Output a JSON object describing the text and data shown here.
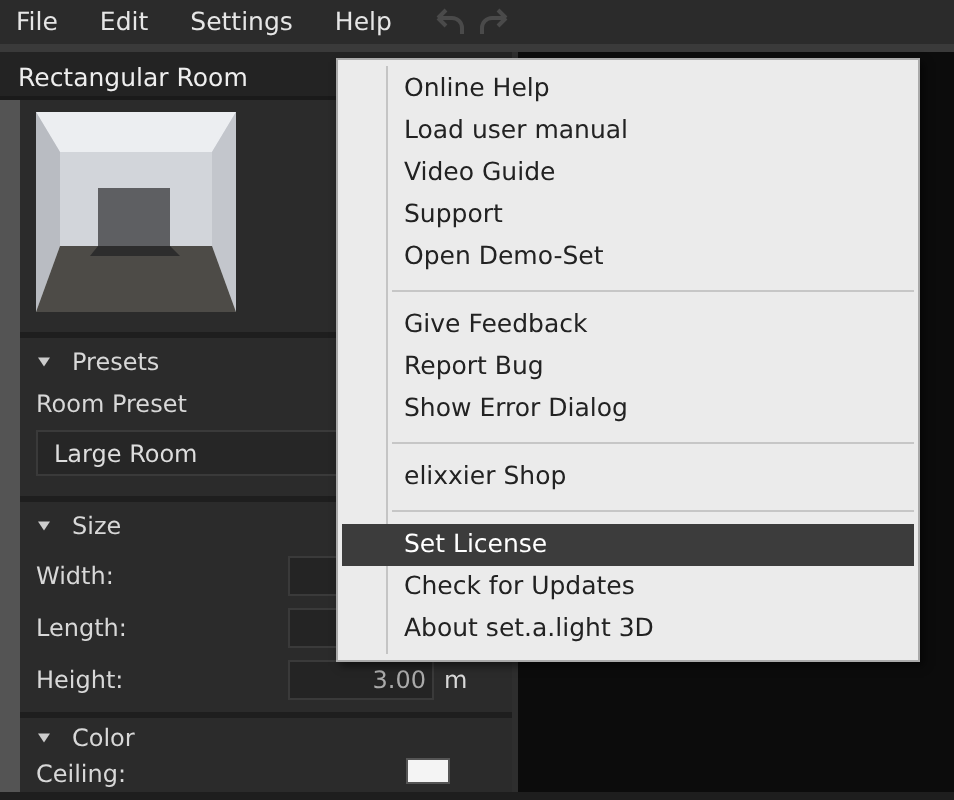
{
  "menubar": [
    {
      "label": "File"
    },
    {
      "label": "Edit"
    },
    {
      "label": "Settings"
    },
    {
      "label": "Help"
    }
  ],
  "toolbar": {
    "undo_disabled": true,
    "redo_disabled": true
  },
  "panel": {
    "title": "Rectangular Room",
    "sections": [
      {
        "title": "Presets",
        "expanded": true,
        "rows": [
          {
            "kind": "label",
            "label": "Room Preset"
          },
          {
            "kind": "select",
            "value": "Large Room"
          }
        ]
      },
      {
        "title": "Size",
        "expanded": true,
        "rows": [
          {
            "kind": "number",
            "label": "Width:"
          },
          {
            "kind": "number",
            "label": "Length:"
          },
          {
            "kind": "number",
            "label": "Height:",
            "value": "3.00",
            "unit": "m"
          }
        ]
      },
      {
        "title": "Color",
        "expanded": true,
        "rows": [
          {
            "kind": "color",
            "label": "Ceiling:"
          }
        ]
      }
    ]
  },
  "help_menu": {
    "groups": [
      [
        {
          "label": "Online Help",
          "selected": false
        },
        {
          "label": "Load user manual",
          "selected": false
        },
        {
          "label": "Video Guide",
          "selected": false
        },
        {
          "label": "Support",
          "selected": false
        },
        {
          "label": "Open Demo-Set",
          "selected": false
        }
      ],
      [
        {
          "label": "Give Feedback",
          "selected": false
        },
        {
          "label": "Report Bug",
          "selected": false
        },
        {
          "label": "Show Error Dialog",
          "selected": false
        }
      ],
      [
        {
          "label": "elixxier Shop",
          "selected": false
        }
      ],
      [
        {
          "label": "Set License",
          "selected": true
        },
        {
          "label": "Check for Updates",
          "selected": false
        },
        {
          "label": "About set.a.light 3D",
          "selected": false
        }
      ]
    ]
  }
}
